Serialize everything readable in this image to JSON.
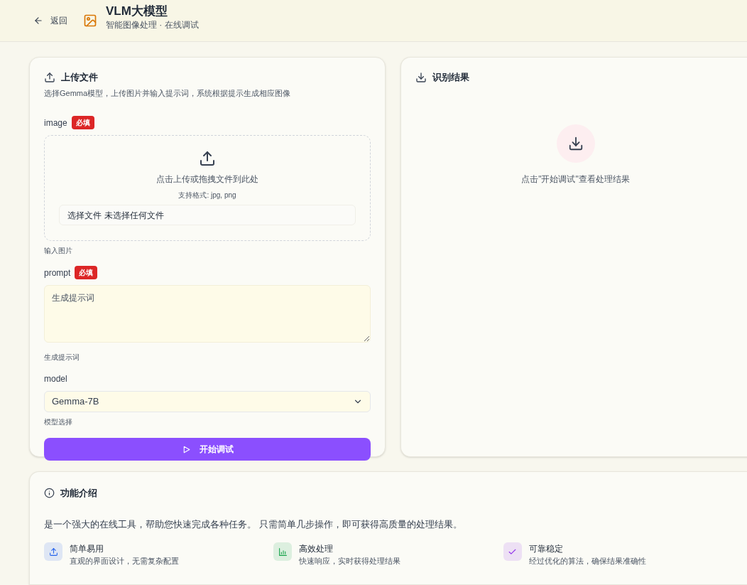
{
  "header": {
    "back": "返回",
    "title": "VLM大模型",
    "subtitle": "智能图像处理 · 在线调试"
  },
  "upload_card": {
    "title": "上传文件",
    "description": "选择Gemma模型，上传图片并输入提示词，系统根据提示生成相应图像",
    "fields": [
      {
        "kind": "file",
        "label": "image",
        "required": true,
        "required_badge": "必填",
        "drop_text": "点击上传或拖拽文件到此处",
        "formats": "支持格式: jpg, png",
        "file_button": "选择文件",
        "file_status": "未选择任何文件",
        "hint": "输入图片"
      },
      {
        "kind": "textarea",
        "label": "prompt",
        "required": true,
        "required_badge": "必填",
        "placeholder": "生成提示词",
        "hint": "生成提示词"
      },
      {
        "kind": "select",
        "label": "model",
        "required": false,
        "value": "Gemma-7B",
        "hint": "模型选择"
      }
    ],
    "submit": "开始调试"
  },
  "result_card": {
    "title": "识别结果",
    "empty_text": "点击\"开始调试\"查看处理结果"
  },
  "intro_card": {
    "title": "功能介绍",
    "description": "是一个强大的在线工具，帮助您快速完成各种任务。 只需简单几步操作，即可获得高质量的处理结果。",
    "features": [
      {
        "kind": "upload",
        "color": "#2563eb",
        "title": "简单易用",
        "text": "直观的界面设计，无需复杂配置"
      },
      {
        "kind": "chart",
        "color": "#16a34a",
        "title": "高效处理",
        "text": "快速响应，实时获得处理结果"
      },
      {
        "kind": "check",
        "color": "#9333ea",
        "title": "可靠稳定",
        "text": "经过优化的算法，确保结果准确性"
      }
    ]
  }
}
